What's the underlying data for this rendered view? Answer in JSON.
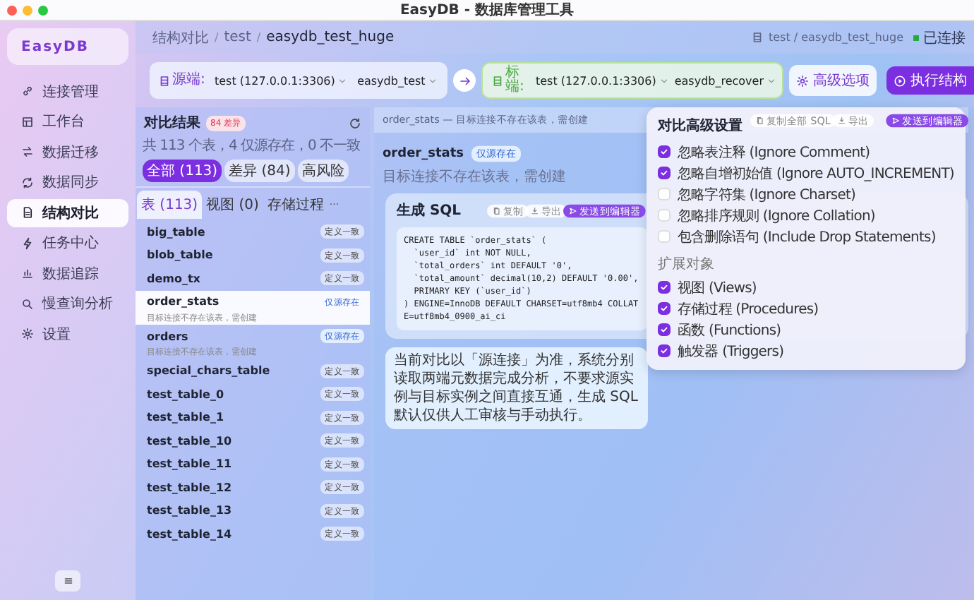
{
  "window": {
    "title": "EasyDB - 数据库管理工具"
  },
  "sidebar": {
    "logo": "EasyDB",
    "items": [
      {
        "label": "连接管理",
        "selected": false
      },
      {
        "label": "工作台",
        "selected": false
      },
      {
        "label": "数据迁移",
        "selected": false
      },
      {
        "label": "数据同步",
        "selected": false
      },
      {
        "label": "结构对比",
        "selected": true
      },
      {
        "label": "任务中心",
        "selected": false
      },
      {
        "label": "数据追踪",
        "selected": false
      },
      {
        "label": "慢查询分析",
        "selected": false
      },
      {
        "label": "设置",
        "selected": false
      }
    ]
  },
  "header": {
    "breadcrumb": [
      "结构对比",
      "test",
      "easydb_test_huge"
    ],
    "separator": "/",
    "current_db": "test / easydb_test_huge",
    "status": {
      "label": "已连接",
      "connected": true
    }
  },
  "source": {
    "label": "源端:",
    "connection": "test (127.0.0.1:3306)",
    "database": "easydb_test"
  },
  "target": {
    "label": "标端:",
    "connection": "test (127.0.0.1:3306)",
    "database": "easydb_recover"
  },
  "advanced_button": "高级选项",
  "run_button": "执行结构",
  "results": {
    "title": "对比结果",
    "diff_badge": "84 差异",
    "summary": "共 113 个表，4 仅源存在，0 不一致",
    "filters": [
      {
        "label": "全部 (113)",
        "selected": true
      },
      {
        "label": "差异 (84)",
        "selected": false
      },
      {
        "label": "高风险",
        "selected": false
      }
    ],
    "tabs": [
      {
        "label": "表 (113)",
        "selected": true
      },
      {
        "label": "视图 (0)",
        "selected": false
      },
      {
        "label": "存储过程",
        "selected": false
      }
    ],
    "more": "···",
    "tables": [
      {
        "name": "big_table",
        "status": "定义一致",
        "kind": "same",
        "selected": false
      },
      {
        "name": "blob_table",
        "status": "定义一致",
        "kind": "same",
        "selected": false
      },
      {
        "name": "demo_tx",
        "status": "定义一致",
        "kind": "same",
        "selected": false
      },
      {
        "name": "order_stats",
        "status": "仅源存在",
        "kind": "source_only",
        "note": "目标连接不存在该表，需创建",
        "selected": true
      },
      {
        "name": "orders",
        "status": "仅源存在",
        "kind": "source_only",
        "note": "目标连接不存在该表，需创建",
        "selected": false
      },
      {
        "name": "special_chars_table",
        "status": "定义一致",
        "kind": "same",
        "selected": false
      },
      {
        "name": "test_table_0",
        "status": "定义一致",
        "kind": "same",
        "selected": false
      },
      {
        "name": "test_table_1",
        "status": "定义一致",
        "kind": "same",
        "selected": false
      },
      {
        "name": "test_table_10",
        "status": "定义一致",
        "kind": "same",
        "selected": false
      },
      {
        "name": "test_table_11",
        "status": "定义一致",
        "kind": "same",
        "selected": false
      },
      {
        "name": "test_table_12",
        "status": "定义一致",
        "kind": "same",
        "selected": false
      },
      {
        "name": "test_table_13",
        "status": "定义一致",
        "kind": "same",
        "selected": false
      },
      {
        "name": "test_table_14",
        "status": "定义一致",
        "kind": "same",
        "selected": false
      }
    ]
  },
  "detail": {
    "banner": "order_stats — 目标连接不存在该表，需创建",
    "toolbar": [
      "复制全部 SQL",
      "导出",
      "发送到编辑器"
    ],
    "name": "order_stats",
    "badge": "仅源存在",
    "note": "目标连接不存在该表，需创建",
    "sql_card": {
      "title": "生成 SQL",
      "buttons": [
        "复制",
        "导出",
        "发送到编辑器"
      ],
      "code": [
        "CREATE TABLE `order_stats` (",
        "  `user_id` int NOT NULL,",
        "  `total_orders` int DEFAULT '0',",
        "  `total_amount` decimal(10,2) DEFAULT '0.00',",
        "  PRIMARY KEY (`user_id`)",
        ") ENGINE=InnoDB DEFAULT CHARSET=utf8mb4 COLLATE=utf8mb4_0900_ai_ci"
      ]
    },
    "info": "当前对比以「源连接」为准，系统分别读取两端元数据完成分析，不要求源实例与目标实例之间直接互通，生成 SQL 默认仅供人工审核与手动执行。"
  },
  "popover": {
    "title": "对比高级设置",
    "options": [
      {
        "label": "忽略表注释 (Ignore Comment)",
        "checked": true
      },
      {
        "label": "忽略自增初始值 (Ignore AUTO_INCREMENT)",
        "checked": true
      },
      {
        "label": "忽略字符集 (Ignore Charset)",
        "checked": false
      },
      {
        "label": "忽略排序规则 (Ignore Collation)",
        "checked": false
      },
      {
        "label": "包含删除语句 (Include Drop Statements)",
        "checked": false
      }
    ],
    "section": "扩展对象",
    "objects": [
      {
        "label": "视图 (Views)",
        "checked": true
      },
      {
        "label": "存储过程 (Procedures)",
        "checked": true
      },
      {
        "label": "函数 (Functions)",
        "checked": true
      },
      {
        "label": "触发器 (Triggers)",
        "checked": true
      }
    ]
  }
}
